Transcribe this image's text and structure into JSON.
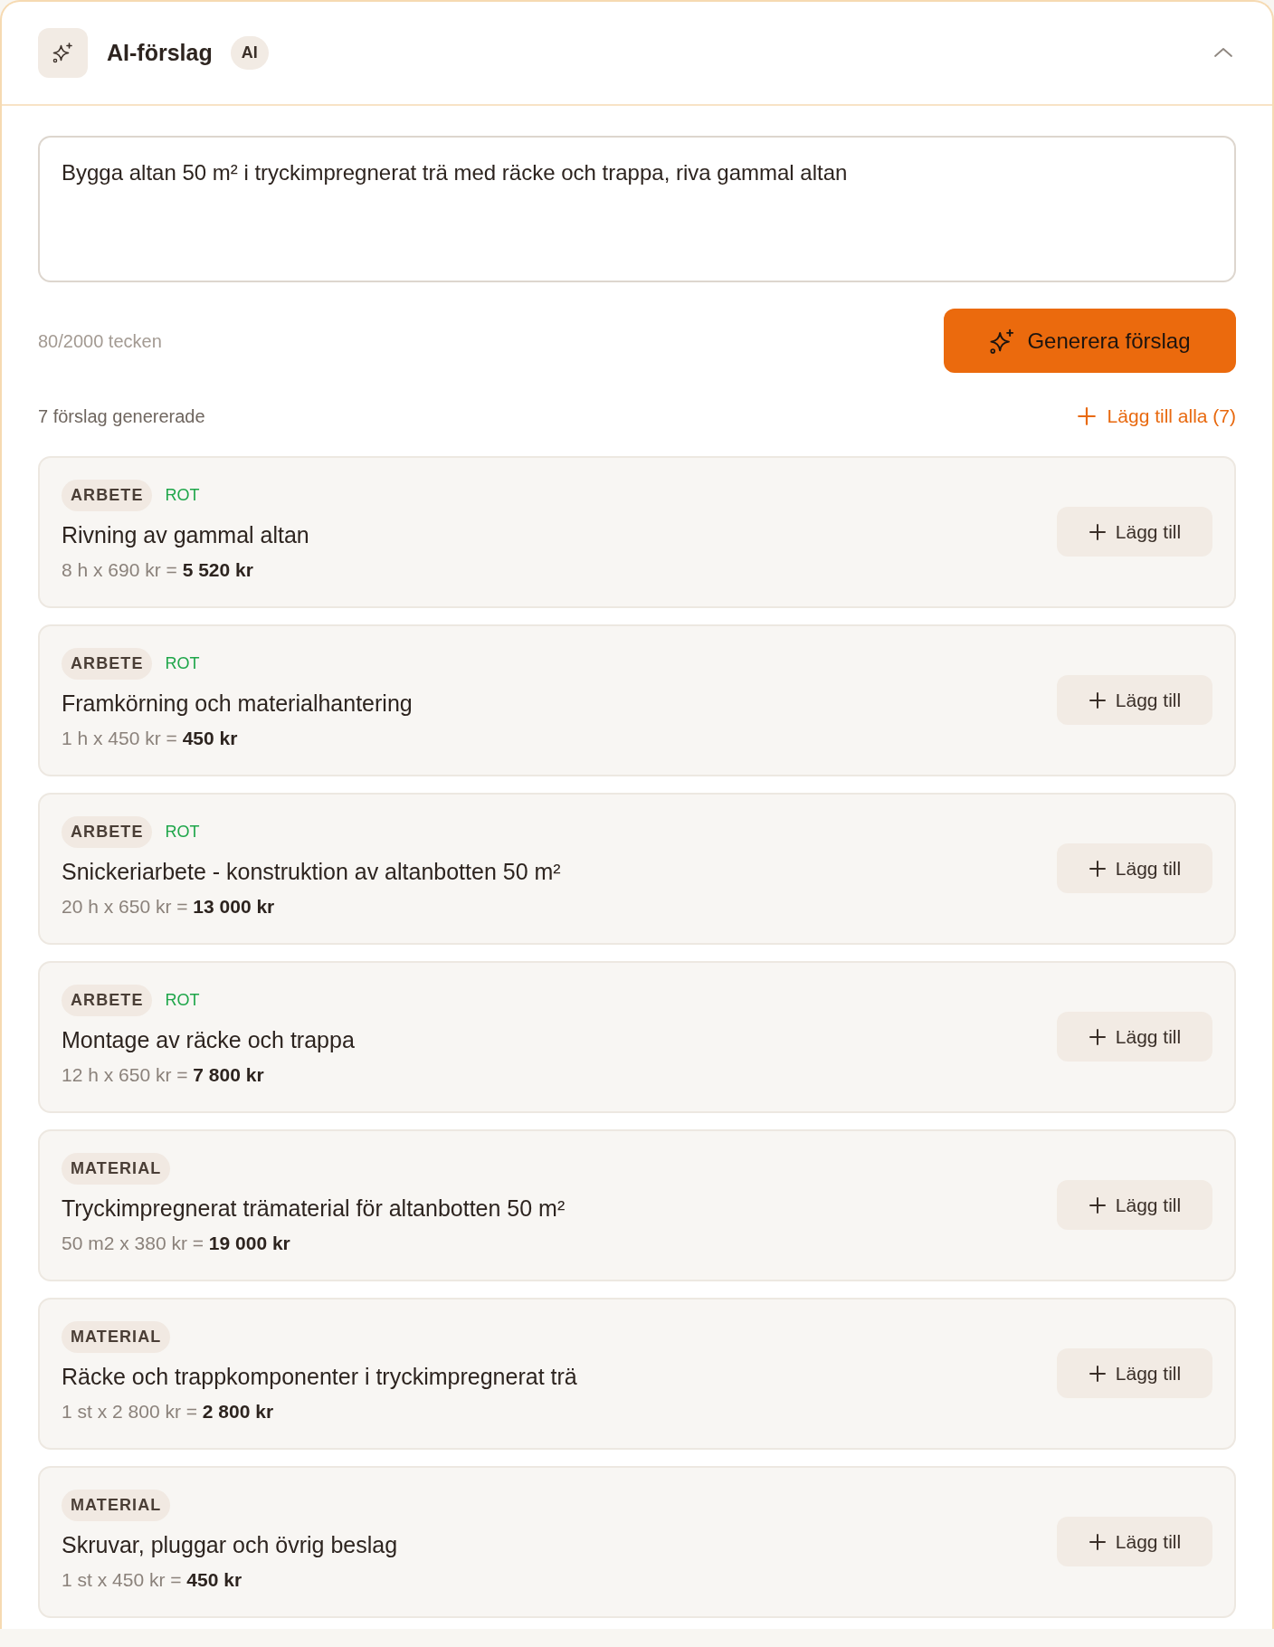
{
  "panel": {
    "title": "AI-förslag",
    "badge": "AI",
    "expanded": true
  },
  "prompt": {
    "value": "Bygga altan 50 m² i tryckimpregnerat trä med räcke och trappa, riva gammal altan",
    "counter": "80/2000 tecken"
  },
  "generate_button": "Generera förslag",
  "results": {
    "summary": "7 förslag genererade",
    "add_all_button": "Lägg till alla (7)"
  },
  "suggestions": [
    {
      "category": "ARBETE",
      "deduction": "ROT",
      "title": "Rivning av gammal altan",
      "calculation": "8 h x 690 kr = **5 520 kr**",
      "button": "Lägg till"
    },
    {
      "category": "ARBETE",
      "deduction": "ROT",
      "title": "Framkörning och materialhantering",
      "calculation": "1 h x 450 kr = **450 kr**",
      "button": "Lägg till"
    },
    {
      "category": "ARBETE",
      "deduction": "ROT",
      "title": "Snickeriarbete - konstruktion av altanbotten 50 m²",
      "calculation": "20 h x 650 kr = **13 000 kr**",
      "button": "Lägg till"
    },
    {
      "category": "ARBETE",
      "deduction": "ROT",
      "title": "Montage av räcke och trappa",
      "calculation": "12 h x 650 kr = **7 800 kr**",
      "button": "Lägg till"
    },
    {
      "category": "MATERIAL",
      "title": "Tryckimpregnerat trämaterial för altanbotten 50 m²",
      "calculation": "50 m2 x 380 kr = **19 000 kr**",
      "button": "Lägg till"
    },
    {
      "category": "MATERIAL",
      "title": "Räcke och trappkomponenter i tryckimpregnerat trä",
      "calculation": "1 st x 2 800 kr = **2 800 kr**",
      "button": "Lägg till"
    },
    {
      "category": "MATERIAL",
      "title": "Skruvar, pluggar och övrig beslag",
      "calculation": "1 st x 450 kr = **450 kr**",
      "button": "Lägg till"
    }
  ]
}
